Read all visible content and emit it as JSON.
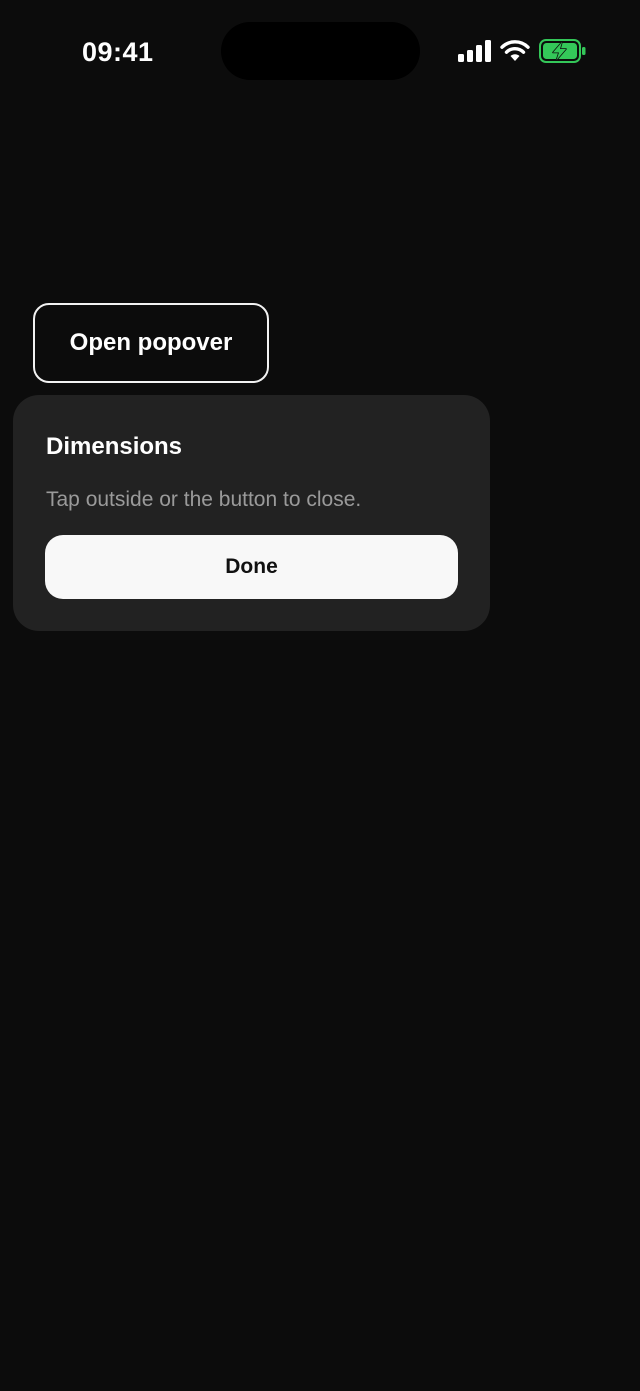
{
  "status_bar": {
    "time": "09:41",
    "icons": [
      "signal-icon",
      "wifi-icon",
      "battery-charging-icon"
    ],
    "battery_color": "#34c759"
  },
  "main": {
    "open_button_label": "Open popover"
  },
  "popover": {
    "title": "Dimensions",
    "message": "Tap outside or the button to close.",
    "done_label": "Done"
  },
  "colors": {
    "background": "#0c0c0c",
    "popover_background": "#222222",
    "primary_button": "#f8f8f8"
  }
}
